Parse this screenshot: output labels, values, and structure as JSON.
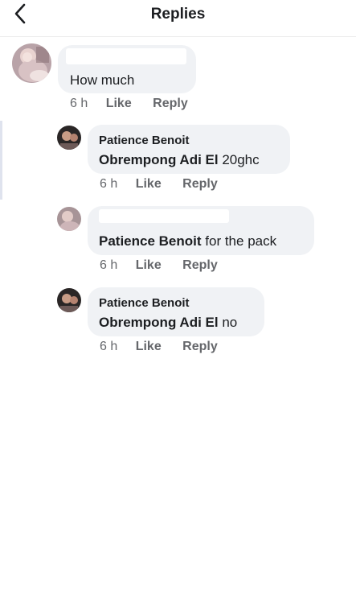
{
  "header": {
    "title": "Replies",
    "back_icon": "chevron-left-icon"
  },
  "comments": [
    {
      "author": "",
      "mention": "",
      "text": "How much",
      "time": "6 h",
      "like": "Like",
      "reply": "Reply"
    },
    {
      "author": "Patience Benoit",
      "mention": "Obrempong Adi El",
      "text": " 20ghc",
      "time": "6 h",
      "like": "Like",
      "reply": "Reply"
    },
    {
      "author": "",
      "mention": "Patience Benoit",
      "text": " for the pack",
      "time": "6 h",
      "like": "Like",
      "reply": "Reply"
    },
    {
      "author": "Patience Benoit",
      "mention": "Obrempong Adi El",
      "text": " no",
      "time": "6 h",
      "like": "Like",
      "reply": "Reply"
    }
  ],
  "colors": {
    "bubble": "#f0f2f5",
    "secondary_text": "#65676b",
    "primary_text": "#1c1e21"
  }
}
